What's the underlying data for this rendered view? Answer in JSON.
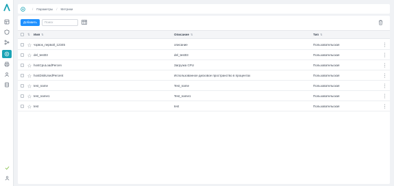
{
  "breadcrumb": {
    "items": [
      "Параметры",
      "Метрики"
    ]
  },
  "toolbar": {
    "add_label": "Добавить",
    "search_placeholder": "Поиск"
  },
  "table": {
    "headers": {
      "name": "Имя",
      "description": "Описание",
      "type": "Тип"
    },
    "rows": [
      {
        "name": "чзрвок_первой_12345",
        "description": "описание",
        "type": "Пользовательская"
      },
      {
        "name": "del_test03",
        "description": "del_test03",
        "type": "Пользовательская"
      },
      {
        "name": "hostCpuLoadPercen",
        "description": "Загрузка CPU",
        "type": "Пользовательская"
      },
      {
        "name": "hostDiskUsedPercent",
        "description": "Использованное дисковое пространство в процентах",
        "type": "Пользовательская"
      },
      {
        "name": "test_name",
        "description": "Test_name",
        "type": "Пользовательская"
      },
      {
        "name": "test_name1",
        "description": "Test_name1",
        "type": "Пользовательская"
      },
      {
        "name": "test",
        "description": "test",
        "type": "Пользовательская"
      }
    ]
  },
  "colors": {
    "accent": "#1aa3b5",
    "primary_button": "#1e90ff"
  },
  "icons": {
    "sidebar": [
      "logo-icon",
      "dashboard-icon",
      "shield-icon",
      "workflow-icon",
      "metrics-icon",
      "printer-icon",
      "users-icon",
      "database-icon",
      "check-icon",
      "user-icon"
    ],
    "toolbar": [
      "columns-icon",
      "trash-icon"
    ],
    "row": [
      "checkbox",
      "star-icon",
      "more-vertical-icon"
    ]
  }
}
